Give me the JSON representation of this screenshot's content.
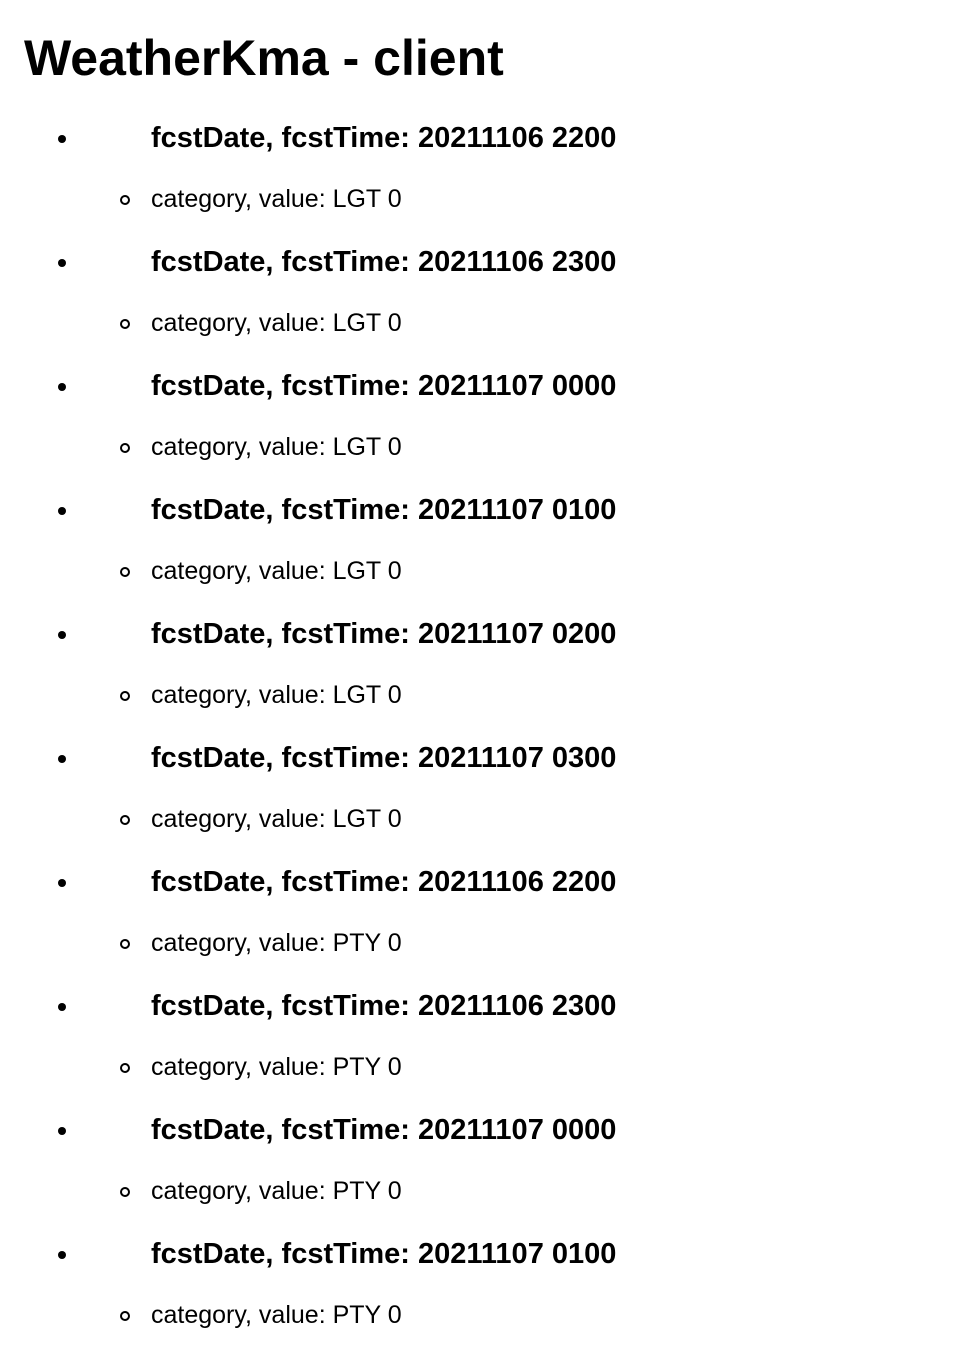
{
  "page": {
    "title": "WeatherKma - client"
  },
  "forecasts": [
    {
      "heading": "fcstDate, fcstTime: 20211106 2200",
      "value": "category, value: LGT 0"
    },
    {
      "heading": "fcstDate, fcstTime: 20211106 2300",
      "value": "category, value: LGT 0"
    },
    {
      "heading": "fcstDate, fcstTime: 20211107 0000",
      "value": "category, value: LGT 0"
    },
    {
      "heading": "fcstDate, fcstTime: 20211107 0100",
      "value": "category, value: LGT 0"
    },
    {
      "heading": "fcstDate, fcstTime: 20211107 0200",
      "value": "category, value: LGT 0"
    },
    {
      "heading": "fcstDate, fcstTime: 20211107 0300",
      "value": "category, value: LGT 0"
    },
    {
      "heading": "fcstDate, fcstTime: 20211106 2200",
      "value": "category, value: PTY 0"
    },
    {
      "heading": "fcstDate, fcstTime: 20211106 2300",
      "value": "category, value: PTY 0"
    },
    {
      "heading": "fcstDate, fcstTime: 20211107 0000",
      "value": "category, value: PTY 0"
    },
    {
      "heading": "fcstDate, fcstTime: 20211107 0100",
      "value": "category, value: PTY 0"
    }
  ]
}
